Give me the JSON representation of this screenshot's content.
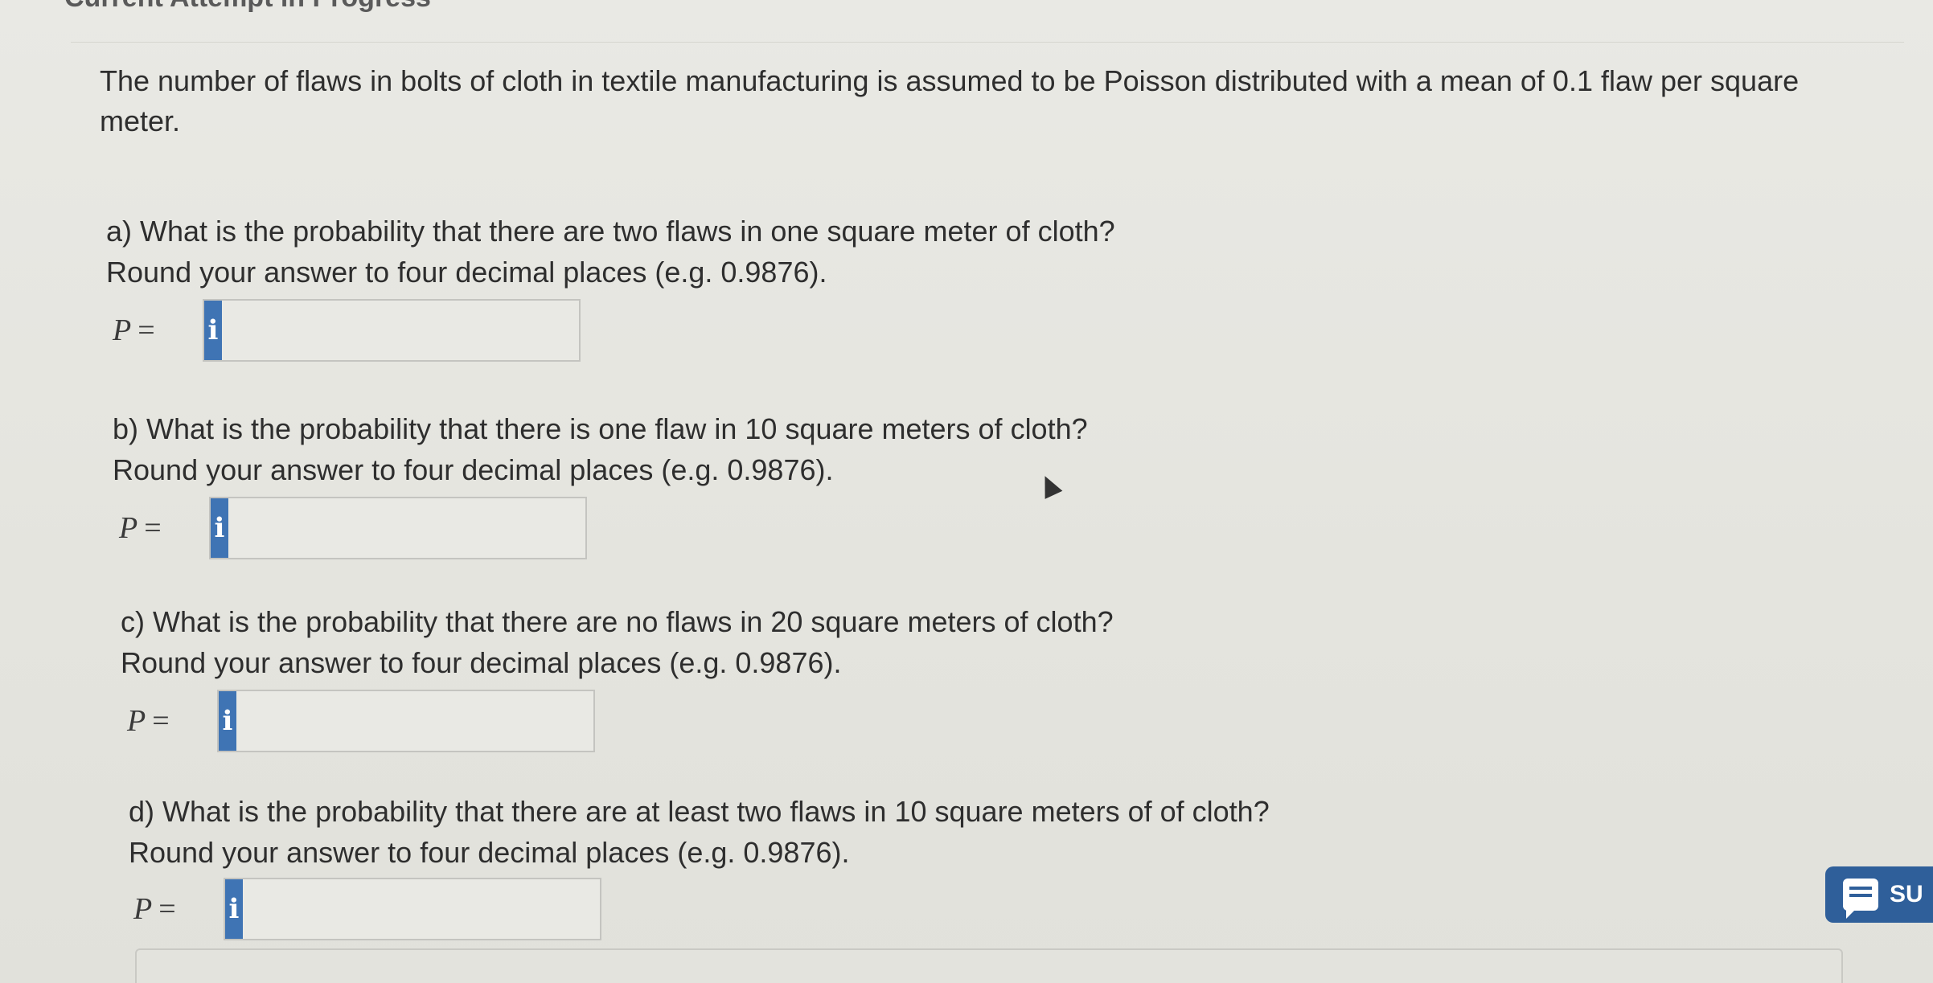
{
  "header": {
    "title": "Current Attempt in Progress"
  },
  "intro_text": "The number of flaws in bolts of cloth in textile manufacturing is assumed to be Poisson distributed with a mean of 0.1 flaw per square meter.",
  "questions": [
    {
      "prompt": "a) What is the probability that there are two flaws in one square meter of cloth?",
      "instruction": "Round your answer to four decimal places (e.g. 0.9876).",
      "label": "P",
      "equals": "=",
      "info_glyph": "i",
      "value": ""
    },
    {
      "prompt": "b) What is the probability that there is one flaw in 10 square meters of cloth?",
      "instruction": "Round your answer to four decimal places (e.g. 0.9876).",
      "label": "P",
      "equals": "=",
      "info_glyph": "i",
      "value": ""
    },
    {
      "prompt": "c) What is the probability that there are no flaws in 20 square meters of cloth?",
      "instruction": "Round your answer to four decimal places (e.g. 0.9876).",
      "label": "P",
      "equals": "=",
      "info_glyph": "i",
      "value": ""
    },
    {
      "prompt": "d) What is the probability that there are at least two flaws in 10 square meters of of cloth?",
      "instruction": "Round your answer to four decimal places (e.g. 0.9876).",
      "label": "P",
      "equals": "=",
      "info_glyph": "i",
      "value": ""
    }
  ],
  "support": {
    "label": "SU",
    "icon": "chat-icon",
    "color": "#2f5f9a"
  },
  "colors": {
    "info_button": "#3f74b4",
    "background": "#e6e6e1"
  }
}
